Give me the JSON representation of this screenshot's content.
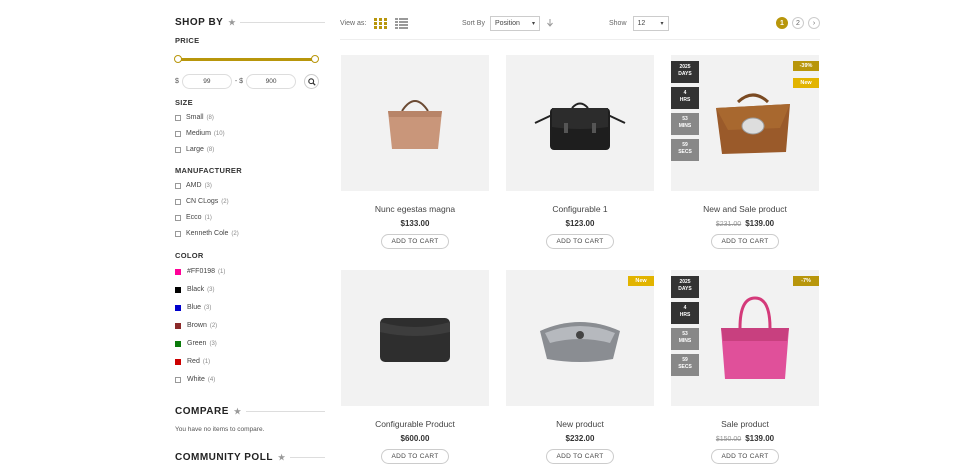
{
  "sidebar": {
    "shop_by": "SHOP BY",
    "price_label": "PRICE",
    "price_currency_from": "$",
    "price_min": "99",
    "price_separator": "- $",
    "price_max": "900",
    "size_label": "SIZE",
    "sizes": [
      {
        "label": "Small",
        "count": "(8)"
      },
      {
        "label": "Medium",
        "count": "(10)"
      },
      {
        "label": "Large",
        "count": "(8)"
      }
    ],
    "manufacturer_label": "MANUFACTURER",
    "manufacturers": [
      {
        "label": "AMD",
        "count": "(3)"
      },
      {
        "label": "CN CLogs",
        "count": "(2)"
      },
      {
        "label": "Ecco",
        "count": "(1)"
      },
      {
        "label": "Kenneth Cole",
        "count": "(2)"
      }
    ],
    "color_label": "COLOR",
    "colors": [
      {
        "label": "#FF0198",
        "count": "(1)",
        "swatch": "#ff0198"
      },
      {
        "label": "Black",
        "count": "(3)",
        "swatch": "#000000"
      },
      {
        "label": "Blue",
        "count": "(3)",
        "swatch": "#0000cc"
      },
      {
        "label": "Brown",
        "count": "(2)",
        "swatch": "#8b2a2a"
      },
      {
        "label": "Green",
        "count": "(3)",
        "swatch": "#0a7a0a"
      },
      {
        "label": "Red",
        "count": "(1)",
        "swatch": "#cc0000"
      },
      {
        "label": "White",
        "count": "(4)",
        "swatch": "#ffffff"
      }
    ],
    "compare_title": "COMPARE",
    "compare_text": "You have no items to compare.",
    "poll_title": "COMMUNITY POLL"
  },
  "toolbar": {
    "view_as": "View as:",
    "sort_by": "Sort By",
    "sort_value": "Position",
    "show": "Show",
    "show_value": "12",
    "pages": [
      "1",
      "2"
    ]
  },
  "products": [
    {
      "name": "Nunc egestas magna",
      "price": "$133.00",
      "old_price": "",
      "cart": "ADD TO CART"
    },
    {
      "name": "Configurable 1",
      "price": "$123.00",
      "old_price": "",
      "cart": "ADD TO CART"
    },
    {
      "name": "New and Sale product",
      "price": "$139.00",
      "old_price": "$231.00",
      "cart": "ADD TO CART",
      "sale": "-39%",
      "new": "New",
      "countdown": [
        "2025",
        "DAYS",
        "4",
        "HRS",
        "53",
        "MINS",
        "59",
        "SECS"
      ]
    },
    {
      "name": "Configurable Product",
      "price": "$600.00",
      "old_price": "",
      "cart": "ADD TO CART"
    },
    {
      "name": "New product",
      "price": "$232.00",
      "old_price": "",
      "cart": "ADD TO CART",
      "new": "New"
    },
    {
      "name": "Sale product",
      "price": "$139.00",
      "old_price": "$150.00",
      "cart": "ADD TO CART",
      "sale": "-7%",
      "countdown": [
        "2025",
        "DAYS",
        "4",
        "HRS",
        "53",
        "MINS",
        "59",
        "SECS"
      ]
    }
  ],
  "colors": {
    "accent": "#b8960b",
    "new_badge": "#e2b400"
  }
}
